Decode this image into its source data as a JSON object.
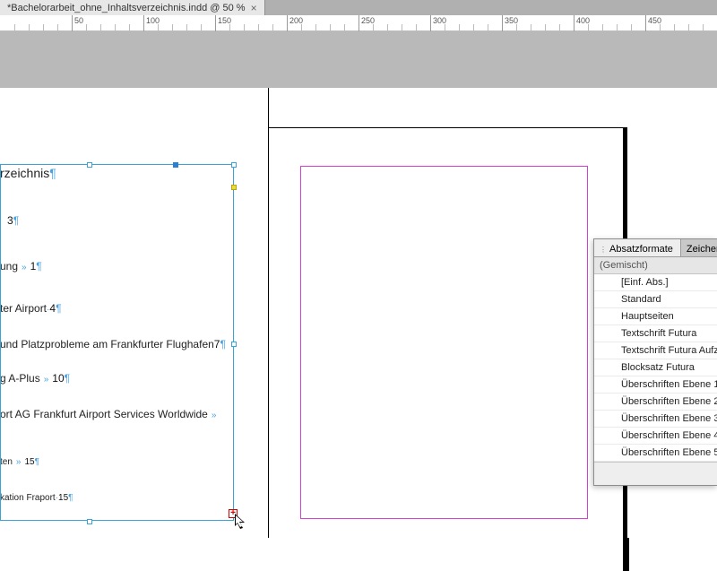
{
  "document": {
    "tab_title": "*Bachelorarbeit_ohne_Inhaltsverzeichnis.indd @ 50 %",
    "zoom": "50 %"
  },
  "ruler_ticks": [
    50,
    100,
    150,
    200,
    250,
    300,
    350,
    400,
    450
  ],
  "text_frame": {
    "lines": {
      "heading": "rzeichnis",
      "l1_prefix": "",
      "l1_num": "3",
      "l2_prefix": "ung",
      "l2_num": "1",
      "l3_prefix": "ter Airport",
      "l3_num": "4",
      "l4_text": "und Platzprobleme am Frankfurter Flughafen",
      "l4_num": "7",
      "l5_prefix": "g A-Plus",
      "l5_num": "10",
      "l6_text": "ort AG Frankfurt Airport Services Worldwide",
      "l7_prefix": "ten",
      "l7_num": "15",
      "l8_prefix": "kation Fraport",
      "l8_num": "15"
    }
  },
  "panel": {
    "tab_active": "Absatzformate",
    "tab_inactive": "Zeichenf",
    "status": "(Gemischt)",
    "styles": [
      "[Einf. Abs.]",
      "Standard",
      "Hauptseiten",
      "Textschrift Futura",
      "Textschrift Futura Aufzäh",
      "Blocksatz Futura",
      "Überschriften Ebene 1",
      "Überschriften Ebene 2",
      "Überschriften Ebene 3",
      "Überschriften Ebene 4",
      "Überschriften Ebene 5"
    ]
  },
  "colors": {
    "selection": "#39a4d6",
    "margin": "#d43fd4",
    "overset": "#d40000"
  }
}
